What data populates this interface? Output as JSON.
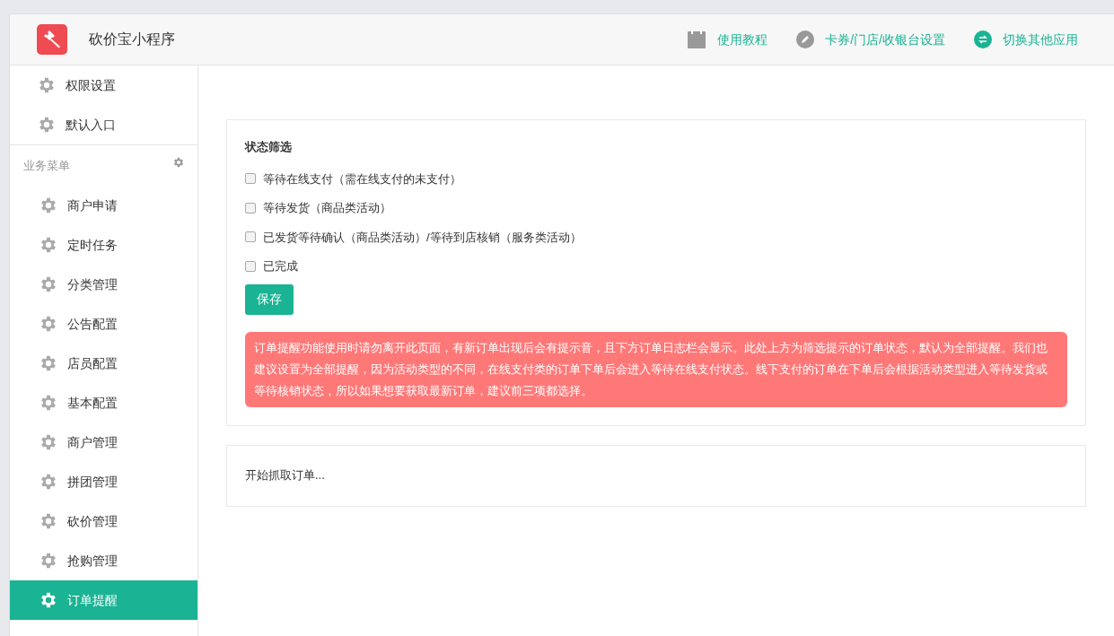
{
  "header": {
    "app_name": "砍价宝小程序",
    "links": [
      {
        "kind": "book",
        "label": "使用教程"
      },
      {
        "kind": "pencil",
        "label": "卡券/门店/收银台设置"
      },
      {
        "kind": "swap",
        "label": "切换其他应用"
      }
    ]
  },
  "sidebar": {
    "top_items": [
      {
        "label": "权限设置",
        "selected": false
      },
      {
        "label": "默认入口",
        "selected": false
      }
    ],
    "section": {
      "title": "业务菜单"
    },
    "items": [
      {
        "label": "商户申请",
        "selected": false
      },
      {
        "label": "定时任务",
        "selected": false
      },
      {
        "label": "分类管理",
        "selected": false
      },
      {
        "label": "公告配置",
        "selected": false
      },
      {
        "label": "店员配置",
        "selected": false
      },
      {
        "label": "基本配置",
        "selected": false
      },
      {
        "label": "商户管理",
        "selected": false
      },
      {
        "label": "拼团管理",
        "selected": false
      },
      {
        "label": "砍价管理",
        "selected": false
      },
      {
        "label": "抢购管理",
        "selected": false
      },
      {
        "label": "订单提醒",
        "selected": true
      }
    ]
  },
  "filter_card": {
    "title": "状态筛选",
    "options": [
      {
        "label": "等待在线支付（需在线支付的未支付）",
        "checked": false
      },
      {
        "label": "等待发货（商品类活动）",
        "checked": false
      },
      {
        "label": "已发货等待确认（商品类活动）/等待到店核销（服务类活动）",
        "checked": false
      },
      {
        "label": "已完成",
        "checked": false
      }
    ],
    "save_button": "保存",
    "notice": "订单提醒功能使用时请勿离开此页面，有新订单出现后会有提示音，且下方订单日志栏会显示。此处上方为筛选提示的订单状态，默认为全部提醒。我们也建议设置为全部提醒，因为活动类型的不同，在线支付类的订单下单后会进入等待在线支付状态。线下支付的订单在下单后会根据活动类型进入等待发货或等待核销状态，所以如果想要获取最新订单，建议前三项都选择。"
  },
  "log_card": {
    "text": "开始抓取订单..."
  }
}
